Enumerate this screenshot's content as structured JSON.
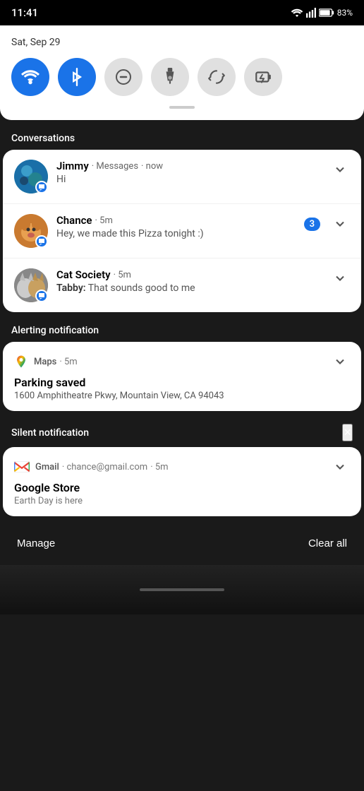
{
  "statusBar": {
    "time": "11:41",
    "battery": "83%",
    "batteryIcon": "battery-icon",
    "signalIcon": "signal-icon",
    "wifiIcon": "wifi-icon"
  },
  "quickSettings": {
    "date": "Sat, Sep 29",
    "toggles": [
      {
        "id": "wifi",
        "label": "WiFi",
        "active": true,
        "symbol": "wifi"
      },
      {
        "id": "bluetooth",
        "label": "Bluetooth",
        "active": true,
        "symbol": "bt"
      },
      {
        "id": "dnd",
        "label": "Do Not Disturb",
        "active": false,
        "symbol": "dnd"
      },
      {
        "id": "flashlight",
        "label": "Flashlight",
        "active": false,
        "symbol": "flash"
      },
      {
        "id": "autorotate",
        "label": "Auto Rotate",
        "active": false,
        "symbol": "rotate"
      },
      {
        "id": "battery-saver",
        "label": "Battery Saver",
        "active": false,
        "symbol": "bsave"
      }
    ]
  },
  "conversations": {
    "sectionLabel": "Conversations",
    "items": [
      {
        "id": "jimmy",
        "sender": "Jimmy",
        "app": "Messages",
        "time": "now",
        "body": "Hi",
        "badge": null
      },
      {
        "id": "chance",
        "sender": "Chance",
        "app": null,
        "time": "5m",
        "body": "Hey, we made this Pizza tonight :)",
        "badge": "3"
      },
      {
        "id": "cat-society",
        "sender": "Cat Society",
        "app": null,
        "time": "5m",
        "bodyPrefix": "Tabby:",
        "body": " That sounds good to me",
        "badge": null
      }
    ]
  },
  "alertingNotification": {
    "sectionLabel": "Alerting notification",
    "app": "Maps",
    "time": "5m",
    "title": "Parking saved",
    "body": "1600 Amphitheatre Pkwy, Mountain View, CA 94043"
  },
  "silentNotification": {
    "sectionLabel": "Silent notification",
    "closeLabel": "×",
    "app": "Gmail",
    "from": "chance@gmail.com",
    "time": "5m",
    "title": "Google Store",
    "body": "Earth Day is here"
  },
  "bottomBar": {
    "manageLabel": "Manage",
    "clearAllLabel": "Clear all"
  }
}
